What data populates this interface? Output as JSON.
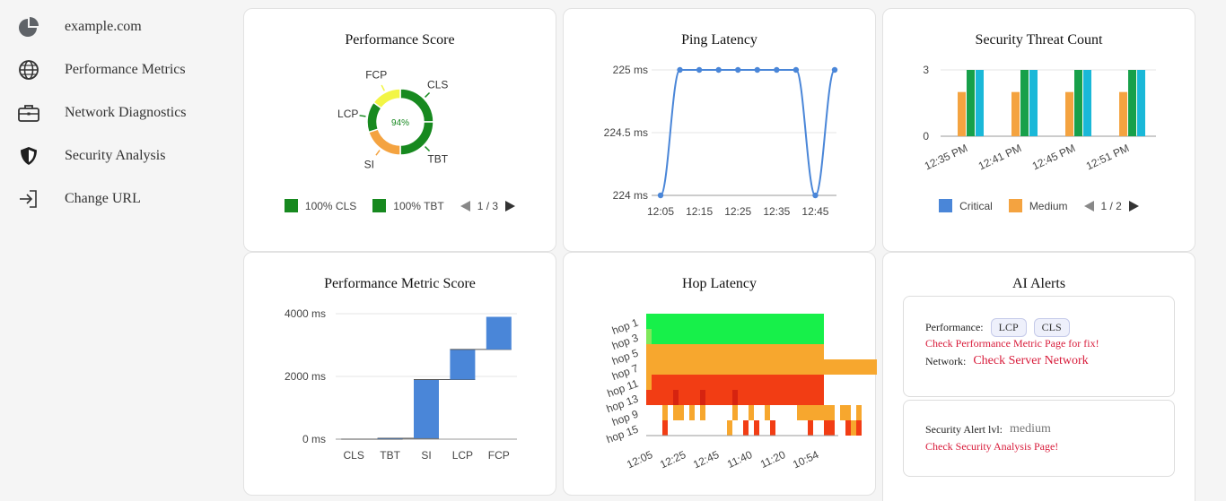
{
  "sidebar": {
    "items": [
      {
        "label": "example.com",
        "icon": "pie-chart-icon"
      },
      {
        "label": "Performance Metrics",
        "icon": "globe-icon"
      },
      {
        "label": "Network Diagnostics",
        "icon": "briefcase-icon"
      },
      {
        "label": "Security Analysis",
        "icon": "shield-icon"
      },
      {
        "label": "Change URL",
        "icon": "login-arrow-icon"
      }
    ]
  },
  "cards": {
    "performance_score": {
      "title": "Performance Score",
      "center_label": "94%",
      "legend": [
        {
          "label": "100% CLS",
          "color": "#17891f"
        },
        {
          "label": "100% TBT",
          "color": "#17891f"
        }
      ],
      "pager": "1 / 3"
    },
    "ping_latency": {
      "title": "Ping Latency"
    },
    "security_threat": {
      "title": "Security Threat Count",
      "legend": [
        {
          "label": "Critical",
          "color": "#4a86d8"
        },
        {
          "label": "Medium",
          "color": "#f4a340"
        }
      ],
      "pager": "1 / 2"
    },
    "metric_score": {
      "title": "Performance Metric Score"
    },
    "hop_latency": {
      "title": "Hop Latency"
    },
    "ai_alerts": {
      "title": "AI Alerts",
      "performance_label": "Performance:",
      "performance_chips": [
        "LCP",
        "CLS"
      ],
      "performance_fix": "Check Performance Metric Page for fix!",
      "network_label": "Network:",
      "network_link": "Check Server Network",
      "security_label": "Security Alert lvl:",
      "security_level": "medium",
      "security_link": "Check Security Analysis Page!"
    }
  },
  "chart_data": [
    {
      "type": "pie",
      "title": "Performance Score",
      "center_label": "94%",
      "categories": [
        "CLS",
        "TBT",
        "SI",
        "LCP",
        "FCP"
      ],
      "values": [
        25,
        25,
        20,
        15,
        15
      ],
      "colors": [
        "#17891f",
        "#17891f",
        "#f4a340",
        "#17891f",
        "#f2f545"
      ]
    },
    {
      "type": "line",
      "title": "Ping Latency",
      "x": [
        "12:05",
        "12:10",
        "12:15",
        "12:20",
        "12:25",
        "12:30",
        "12:35",
        "12:40",
        "12:45",
        "12:50"
      ],
      "x_ticks": [
        "12:05",
        "12:15",
        "12:25",
        "12:35",
        "12:45"
      ],
      "values": [
        224,
        225,
        225,
        225,
        225,
        225,
        225,
        225,
        224,
        225
      ],
      "y_ticks": [
        "224 ms",
        "224.5 ms",
        "225 ms"
      ],
      "ylim": [
        224,
        225
      ],
      "color": "#4a86d8",
      "grid": true
    },
    {
      "type": "bar",
      "title": "Security Threat Count",
      "categories": [
        "12:35 PM",
        "12:41 PM",
        "12:45 PM",
        "12:51 PM"
      ],
      "series": [
        {
          "name": "Medium",
          "color": "#f4a340",
          "values": [
            2,
            2,
            2,
            2
          ]
        },
        {
          "color": "#17a04a",
          "values": [
            3,
            3,
            3,
            3
          ]
        },
        {
          "color": "#1ab8d8",
          "values": [
            3,
            3,
            3,
            3
          ]
        }
      ],
      "legend_series": [
        "Critical",
        "Medium"
      ],
      "y_ticks": [
        "0",
        "3"
      ],
      "ylim": [
        0,
        3
      ]
    },
    {
      "type": "bar",
      "title": "Performance Metric Score",
      "subtype": "waterfall",
      "categories": [
        "CLS",
        "TBT",
        "SI",
        "LCP",
        "FCP"
      ],
      "values": [
        0,
        30,
        1870,
        960,
        1040
      ],
      "y_ticks": [
        "0 ms",
        "2000 ms",
        "4000 ms"
      ],
      "ylim": [
        0,
        4000
      ],
      "color": "#4a86d8"
    },
    {
      "type": "heatmap",
      "title": "Hop Latency",
      "y_labels": [
        "hop 1",
        "hop 3",
        "hop 5",
        "hop 7",
        "hop 11",
        "hop 13",
        "hop 9",
        "hop 15"
      ],
      "x_ticks": [
        "12:05",
        "12:25",
        "12:45",
        "11:40",
        "11:20",
        "10:54"
      ],
      "rows": [
        "GGGGGGGGGGGGGGGGGGGGGGGGGGGGGGGGG",
        "gGGGGGGGGGGGGGGGGGGGGGGGGGGGGGGGG",
        "OOOOOOOOOOOOOOOOOOOOOOOOOOOOOOOOO",
        "OOOOOOOOOOOOOOOOOOOOOOOOOOOOOOOOOOOOOOOOOOOOOOOOOO",
        "ORRRRRRRRRRRRRRRRRRRRRRRRRRRRRRRR",
        "RRRRRDRRRRDRRRRRDRRRRRRRRRRRRRRRR",
        "...O.OO.O.O.....O..O..O.....OOOOOOO.OO.O",
        "...R...........O..R.R..R......R..RR..ROR"
      ]
    }
  ]
}
